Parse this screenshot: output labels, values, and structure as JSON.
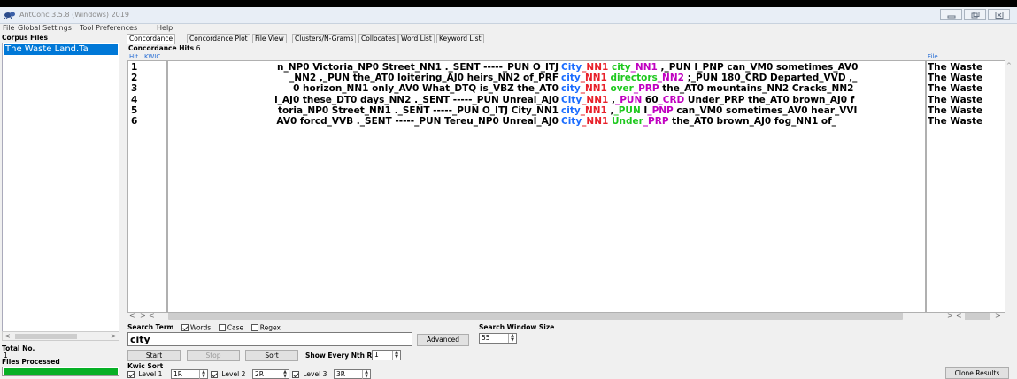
{
  "window": {
    "title": "AntConc 3.5.8 (Windows) 2019"
  },
  "menu": [
    "File",
    "Global Settings",
    "Tool Preferences",
    "Help"
  ],
  "left_panel": {
    "corpus_files_label": "Corpus Files",
    "corpus_files": [
      "The Waste Land.Ta"
    ],
    "total_no_label": "Total No.",
    "total_no_value": "1",
    "files_processed_label": "Files Processed",
    "progress": 1.0
  },
  "tabs": [
    "Concordance",
    "Concordance Plot",
    "File View",
    "Clusters/N-Grams",
    "Collocates",
    "Word List",
    "Keyword List"
  ],
  "concordance": {
    "hits_label": "Concordance Hits",
    "hits_count": "6",
    "col_hit": "Hit",
    "col_kwic": "KWIC",
    "col_file": "File",
    "rows": [
      {
        "hit": "1",
        "left": "n_NP0 Victoria_NP0 Street_NN1 ._SENT -----_PUN O_ITJ",
        "right": [
          {
            "t": "City",
            "c": "blue"
          },
          {
            "t": "_NN1",
            "c": "red"
          },
          {
            "t": " "
          },
          {
            "t": "city",
            "c": "green"
          },
          {
            "t": "_NN1",
            "c": "purple"
          },
          {
            "t": " ,_PUN I_PNP can_VM0 sometimes_AV0"
          }
        ],
        "file": "The Waste"
      },
      {
        "hit": "2",
        "left": "_NN2 ,_PUN the_AT0 loitering_AJ0 heirs_NN2 of_PRF",
        "right": [
          {
            "t": "city",
            "c": "blue"
          },
          {
            "t": "_NN1",
            "c": "red"
          },
          {
            "t": " "
          },
          {
            "t": "directors",
            "c": "green"
          },
          {
            "t": "_NN2",
            "c": "purple"
          },
          {
            "t": " ;_PUN 180_CRD Departed_VVD ,_"
          }
        ],
        "file": "The Waste"
      },
      {
        "hit": "3",
        "left": "0 horizon_NN1 only_AV0 What_DTQ is_VBZ the_AT0",
        "right": [
          {
            "t": "city",
            "c": "blue"
          },
          {
            "t": "_NN1",
            "c": "red"
          },
          {
            "t": " "
          },
          {
            "t": "over",
            "c": "green"
          },
          {
            "t": "_PRP",
            "c": "purple"
          },
          {
            "t": " the_AT0 mountains_NN2 Cracks_NN2"
          }
        ],
        "file": "The Waste"
      },
      {
        "hit": "4",
        "left": "l_AJ0 these_DT0 days_NN2 ._SENT -----_PUN Unreal_AJ0",
        "right": [
          {
            "t": "City",
            "c": "blue"
          },
          {
            "t": "_NN1",
            "c": "red"
          },
          {
            "t": " ,"
          },
          {
            "t": "_PUN",
            "c": "purple"
          },
          {
            "t": " 60"
          },
          {
            "t": "_CRD",
            "c": "purple"
          },
          {
            "t": " Under_PRP the_AT0 brown_AJ0 f"
          }
        ],
        "file": "The Waste"
      },
      {
        "hit": "5",
        "left": "toria_NP0 Street_NN1 ._SENT -----_PUN O_ITJ City_NN1",
        "right": [
          {
            "t": "city",
            "c": "blue"
          },
          {
            "t": "_NN1",
            "c": "red"
          },
          {
            "t": " ,"
          },
          {
            "t": "_PUN",
            "c": "green"
          },
          {
            "t": " I"
          },
          {
            "t": "_PNP",
            "c": "purple"
          },
          {
            "t": " can_VM0 sometimes_AV0 hear_VVI"
          }
        ],
        "file": "The Waste"
      },
      {
        "hit": "6",
        "left": "AV0 forcd_VVB ._SENT -----_PUN Tereu_NP0 Unreal_AJ0",
        "right": [
          {
            "t": "City",
            "c": "blue"
          },
          {
            "t": "_NN1",
            "c": "red"
          },
          {
            "t": " "
          },
          {
            "t": "Under",
            "c": "green"
          },
          {
            "t": "_PRP",
            "c": "purple"
          },
          {
            "t": " the_AT0 brown_AJ0 fog_NN1 of_"
          }
        ],
        "file": "The Waste"
      }
    ]
  },
  "search": {
    "label": "Search Term",
    "words_label": "Words",
    "case_label": "Case",
    "regex_label": "Regex",
    "words_checked": true,
    "case_checked": false,
    "regex_checked": false,
    "value": "city",
    "advanced_label": "Advanced",
    "window_size_label": "Search Window Size",
    "window_size": "55",
    "start_label": "Start",
    "stop_label": "Stop",
    "sort_label": "Sort",
    "show_every_label": "Show Every Nth Row",
    "show_every_value": "1"
  },
  "kwic_sort": {
    "label": "Kwic Sort",
    "levels": [
      {
        "label": "Level 1",
        "value": "1R"
      },
      {
        "label": "Level 2",
        "value": "2R"
      },
      {
        "label": "Level 3",
        "value": "3R"
      }
    ]
  },
  "clone_results_label": "Clone Results",
  "colors": {
    "blue": "#1a6cff",
    "red": "#e8202a",
    "green": "#1ec81e",
    "purple": "#c000c0",
    "selection": "#0078d7",
    "progress": "#06b025"
  }
}
